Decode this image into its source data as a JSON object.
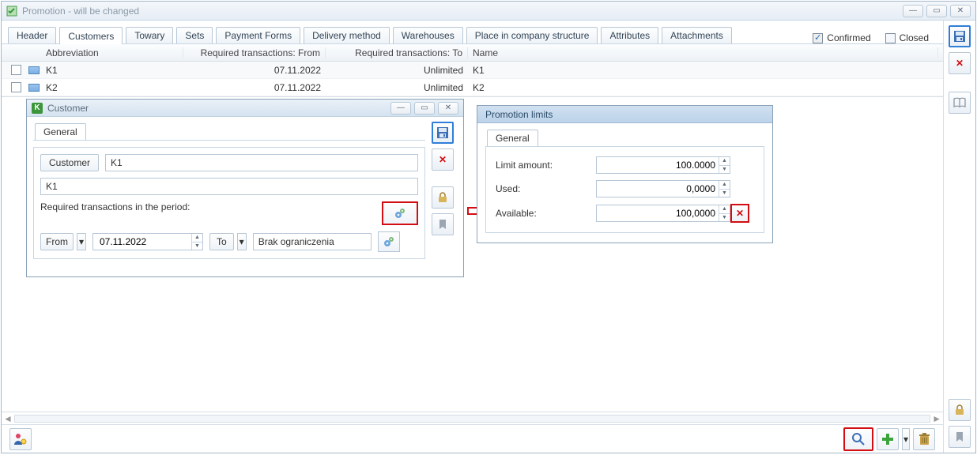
{
  "window": {
    "title": "Promotion - will be changed"
  },
  "tabs": {
    "items": [
      "Header",
      "Customers",
      "Towary",
      "Sets",
      "Payment Forms",
      "Delivery method",
      "Warehouses",
      "Place in company structure",
      "Attributes",
      "Attachments"
    ],
    "active": 1,
    "confirmed_label": "Confirmed",
    "closed_label": "Closed"
  },
  "grid": {
    "cols": {
      "abbrev": "Abbreviation",
      "from": "Required transactions: From",
      "to": "Required transactions: To",
      "name": "Name"
    },
    "rows": [
      {
        "abbrev": "K1",
        "from": "07.11.2022",
        "to": "Unlimited",
        "name": "K1"
      },
      {
        "abbrev": "K2",
        "from": "07.11.2022",
        "to": "Unlimited",
        "name": "K2"
      }
    ]
  },
  "customer_win": {
    "title": "Customer",
    "tab_general": "General",
    "customer_btn": "Customer",
    "customer_code": "K1",
    "customer_name": "K1",
    "req_label": "Required transactions in the period:",
    "from_label": "From",
    "from_value": "07.11.2022",
    "to_label": "To",
    "to_value": "Brak ograniczenia"
  },
  "limits_win": {
    "title": "Promotion limits",
    "tab_general": "General",
    "limit_label": "Limit amount:",
    "limit_value": "100.0000",
    "used_label": "Used:",
    "used_value": "0,0000",
    "avail_label": "Available:",
    "avail_value": "100,0000"
  }
}
